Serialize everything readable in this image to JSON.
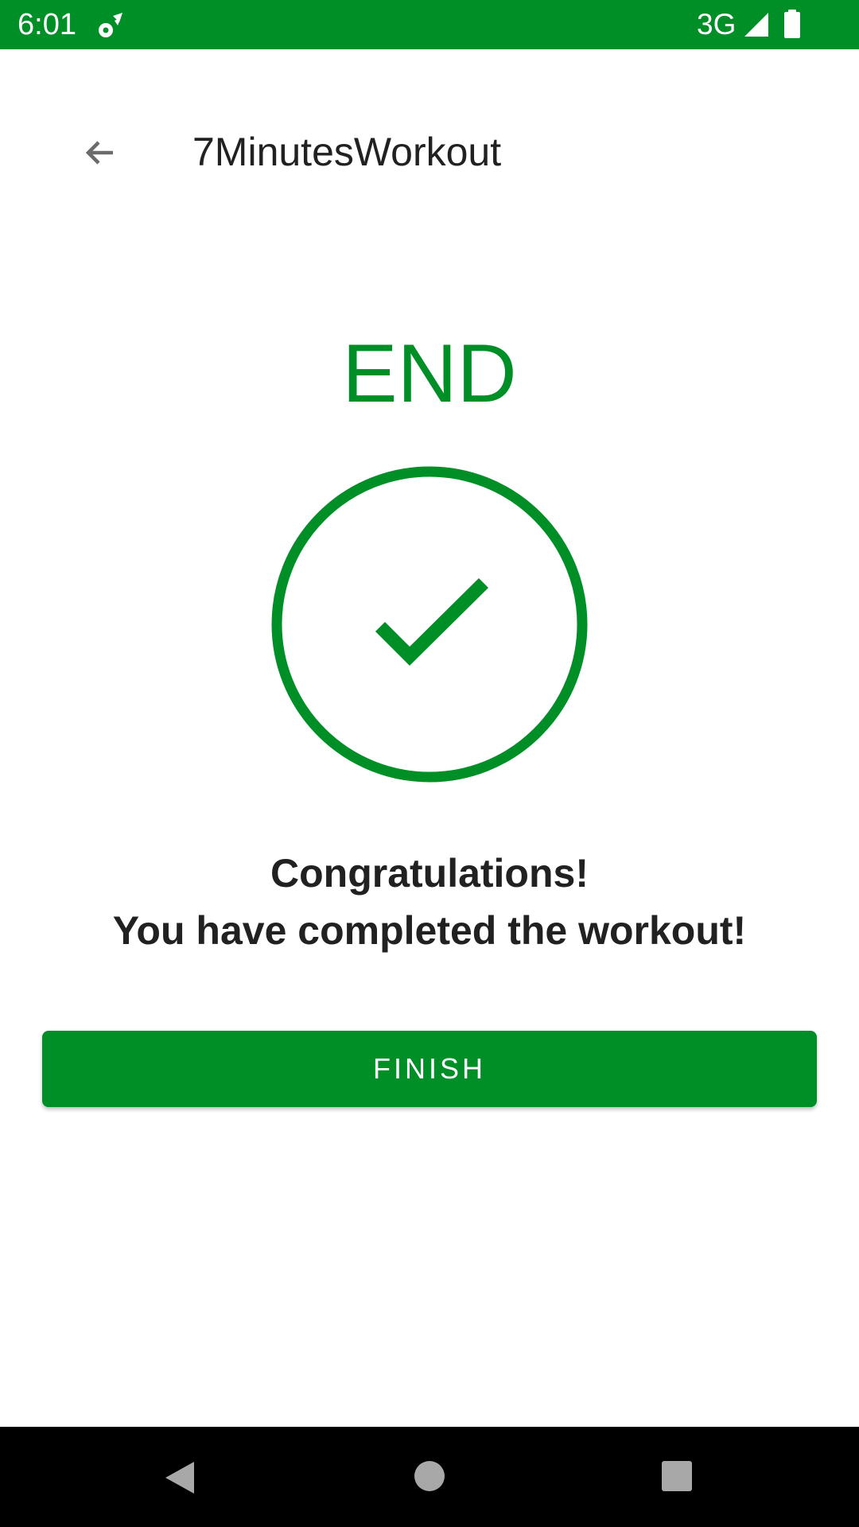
{
  "status_bar": {
    "time": "6:01",
    "network_type": "3G",
    "icons": [
      "gear-icon",
      "signal-icon",
      "battery-icon"
    ],
    "background_color": "#008f26"
  },
  "app_bar": {
    "title": "7MinutesWorkout",
    "back_icon": "arrow-back-icon"
  },
  "main": {
    "end_label": "END",
    "check_icon": "check-circle-icon",
    "congrats_line1": "Congratulations!",
    "congrats_line2": "You have completed the workout!",
    "accent_color": "#008f26"
  },
  "finish_button": {
    "label": "FINISH"
  },
  "nav_bar": {
    "icons": [
      "nav-back-icon",
      "nav-home-icon",
      "nav-recents-icon"
    ]
  }
}
